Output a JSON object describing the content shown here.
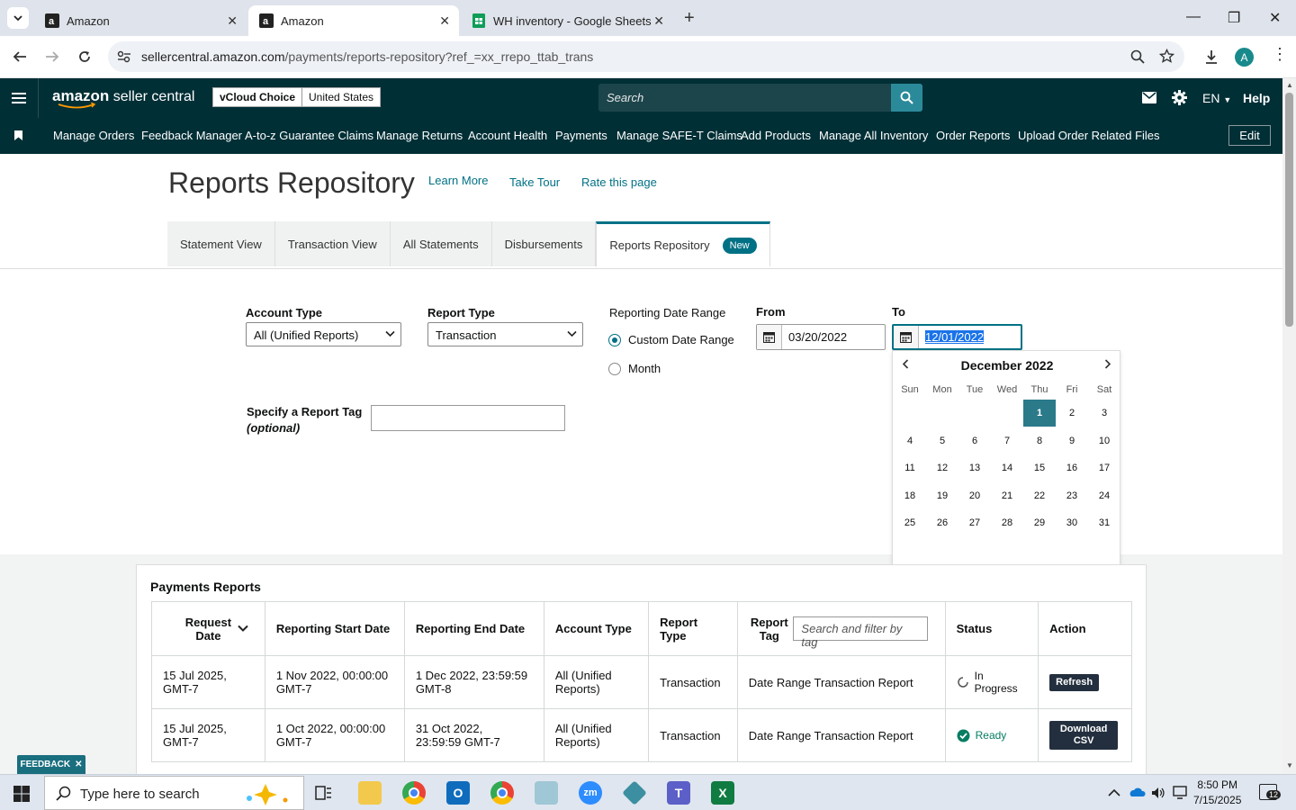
{
  "browser": {
    "tabs": [
      {
        "title": "Amazon",
        "active": false
      },
      {
        "title": "Amazon",
        "active": true
      },
      {
        "title": "WH inventory - Google Sheets",
        "active": false
      }
    ],
    "url_host": "sellercentral.amazon.com",
    "url_path": "/payments/reports-repository?ref_=xx_rrepo_ttab_trans",
    "profile_initial": "A"
  },
  "header": {
    "logo_a": "amazon",
    "logo_b": " seller central",
    "store_name": "vCloud Choice",
    "store_region": "United States",
    "search_placeholder": "Search",
    "lang": "EN",
    "help": "Help"
  },
  "nav": {
    "items": [
      "Manage Orders",
      "Feedback Manager",
      "A-to-z Guarantee Claims",
      "Manage Returns",
      "Account Health",
      "Payments",
      "Manage SAFE-T Claims",
      "Add Products",
      "Manage All Inventory",
      "Order Reports",
      "Upload Order Related Files"
    ],
    "edit": "Edit"
  },
  "page": {
    "title": "Reports Repository",
    "links": [
      "Learn More",
      "Take Tour",
      "Rate this page"
    ],
    "tabs": [
      "Statement View",
      "Transaction View",
      "All Statements",
      "Disbursements",
      "Reports Repository"
    ],
    "new_badge": "New"
  },
  "form": {
    "account_type_label": "Account Type",
    "account_type_value": "All (Unified Reports)",
    "report_type_label": "Report Type",
    "report_type_value": "Transaction",
    "date_range_label": "Reporting Date Range",
    "custom_range": "Custom Date Range",
    "month": "Month",
    "from_label": "From",
    "from_value": "03/20/2022",
    "to_label": "To",
    "to_value": "12/01/2022",
    "tag_label": "Specify a Report Tag",
    "tag_optional": "(optional)"
  },
  "calendar": {
    "month_title": "December 2022",
    "dow": [
      "Sun",
      "Mon",
      "Tue",
      "Wed",
      "Thu",
      "Fri",
      "Sat"
    ],
    "first_weekday": 4,
    "days": 31,
    "selected": 1
  },
  "reports": {
    "title": "Payments Reports",
    "headers": [
      "Request Date",
      "Reporting Start Date",
      "Reporting End Date",
      "Account Type",
      "Report Type",
      "Report Tag",
      "Status",
      "Action"
    ],
    "tag_search_placeholder": "Search and filter by tag",
    "rows": [
      {
        "request": "15 Jul 2025, GMT-7",
        "start": "1 Nov 2022, 00:00:00 GMT-7",
        "end": "1 Dec 2022, 23:59:59 GMT-8",
        "account": "All (Unified Reports)",
        "type": "Transaction",
        "tag": "Date Range Transaction Report",
        "status": "In Progress",
        "action": "Refresh"
      },
      {
        "request": "15 Jul 2025, GMT-7",
        "start": "1 Oct 2022, 00:00:00 GMT-7",
        "end": "31 Oct 2022, 23:59:59 GMT-7",
        "account": "All (Unified Reports)",
        "type": "Transaction",
        "tag": "Date Range Transaction Report",
        "status": "Ready",
        "action": "Download CSV"
      }
    ]
  },
  "feedback": "FEEDBACK",
  "taskbar": {
    "search_text": "Type here to search",
    "time": "8:50 PM",
    "date": "7/15/2025",
    "notif_count": "12"
  }
}
